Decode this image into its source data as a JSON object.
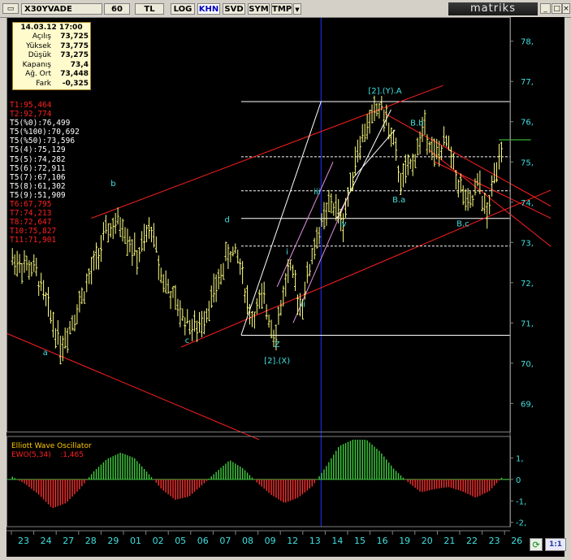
{
  "toolbar": {
    "symbol": "X30YVADE",
    "period": "60",
    "buttons": [
      "TL",
      "LOG",
      "KHN",
      "SVD",
      "SYM",
      "TMP"
    ],
    "active_button": "KHN",
    "brand": "matriks",
    "window_controls": [
      "_",
      "□",
      "×"
    ]
  },
  "infobox": {
    "datetime": "14.03.12 17:00",
    "rows": [
      {
        "label": "Açılış",
        "value": "73,725"
      },
      {
        "label": "Yüksek",
        "value": "73,775"
      },
      {
        "label": "Düşük",
        "value": "73,275"
      },
      {
        "label": "Kapanış",
        "value": "73,4"
      },
      {
        "label": "Ağ. Ort",
        "value": "73,448"
      },
      {
        "label": "Fark",
        "value": "-0,325"
      }
    ]
  },
  "levels": [
    {
      "text": "T1:95,464",
      "color": "#ff2020"
    },
    {
      "text": "T2:92,774",
      "color": "#ff2020"
    },
    {
      "text": "T5(%0):76,499",
      "color": "#ffffff"
    },
    {
      "text": "T5(%100):70,692",
      "color": "#ffffff"
    },
    {
      "text": "T5(%50):73,596",
      "color": "#ffffff"
    },
    {
      "text": "T5(4):75,129",
      "color": "#ffffff"
    },
    {
      "text": "T5(5):74,282",
      "color": "#ffffff"
    },
    {
      "text": "T5(6):72,911",
      "color": "#ffffff"
    },
    {
      "text": "T5(7):67,106",
      "color": "#ffffff"
    },
    {
      "text": "T5(8):61,302",
      "color": "#ffffff"
    },
    {
      "text": "T5(9):51,909",
      "color": "#ffffff"
    },
    {
      "text": "T6:67,795",
      "color": "#ff2020"
    },
    {
      "text": "T7:74,213",
      "color": "#ff2020"
    },
    {
      "text": "T8:72,647",
      "color": "#ff2020"
    },
    {
      "text": "T10:75,827",
      "color": "#ff2020"
    },
    {
      "text": "T11:71,901",
      "color": "#ff2020"
    }
  ],
  "oscillator": {
    "title": "Elliott Wave Oscillator",
    "label": "EWO(5,34)",
    "value": ":1,465",
    "ticks": [
      {
        "v": 1,
        "label": "1,"
      },
      {
        "v": 0,
        "label": "0"
      },
      {
        "v": -1,
        "label": "-1,"
      },
      {
        "v": -2,
        "label": "-2,"
      }
    ]
  },
  "colors": {
    "background": "#000000",
    "price_bars": "#ffff80",
    "trendline": "#ff2020",
    "channel": "#ffffff",
    "channel_violet": "#e090e0",
    "labels": "#40e0e0",
    "axis_text": "#40e0e0",
    "osc_positive": "#40d040",
    "osc_negative": "#ff3030"
  },
  "chart_data": {
    "type": "ohlc",
    "title": "X30YVADE 60",
    "y_axis_ticks": [
      {
        "v": 78,
        "label": "78,"
      },
      {
        "v": 77,
        "label": "77,"
      },
      {
        "v": 76,
        "label": "76,"
      },
      {
        "v": 75,
        "label": "75,"
      },
      {
        "v": 74,
        "label": "74,"
      },
      {
        "v": 73,
        "label": "73,"
      },
      {
        "v": 72,
        "label": "72,"
      },
      {
        "v": 71,
        "label": "71,"
      },
      {
        "v": 70,
        "label": "70,"
      },
      {
        "v": 69,
        "label": "69,"
      }
    ],
    "ylim": [
      68.3,
      78.6
    ],
    "x_tick_labels": [
      "23",
      "24",
      "27",
      "28",
      "29",
      "01",
      "02",
      "05",
      "06",
      "07",
      "08",
      "09",
      "12",
      "13",
      "14",
      "15",
      "16",
      "19",
      "20",
      "21",
      "22",
      "23",
      "26"
    ],
    "price_path": [
      [
        0,
        72.6
      ],
      [
        1.2,
        72.3
      ],
      [
        2.5,
        70.4
      ],
      [
        3.5,
        71.6
      ],
      [
        4.8,
        73.3
      ],
      [
        5.5,
        73.5
      ],
      [
        6.3,
        72.6
      ],
      [
        7.0,
        73.4
      ],
      [
        7.5,
        72.2
      ],
      [
        8.5,
        71.2
      ],
      [
        9.3,
        70.8
      ],
      [
        10.2,
        71.8
      ],
      [
        10.9,
        72.8
      ],
      [
        11.4,
        72.6
      ],
      [
        12.0,
        71.1
      ],
      [
        12.6,
        71.6
      ],
      [
        13.2,
        70.7
      ],
      [
        13.9,
        72.4
      ],
      [
        14.5,
        71.4
      ],
      [
        15.2,
        73.0
      ],
      [
        16.0,
        74.0
      ],
      [
        16.6,
        73.5
      ],
      [
        17.3,
        75.3
      ],
      [
        18.0,
        76.1
      ],
      [
        18.5,
        76.4
      ],
      [
        19.1,
        75.5
      ],
      [
        19.5,
        74.5
      ],
      [
        20.1,
        75.0
      ],
      [
        20.7,
        75.9
      ],
      [
        21.2,
        75.1
      ],
      [
        21.8,
        75.5
      ],
      [
        22.3,
        74.6
      ],
      [
        22.9,
        73.8
      ],
      [
        23.4,
        74.5
      ],
      [
        23.8,
        73.6
      ],
      [
        24.3,
        75.0
      ],
      [
        24.6,
        75.6
      ]
    ],
    "horizontal_levels": [
      {
        "v": 76.5,
        "style": "solid",
        "x_from": 11.5
      },
      {
        "v": 75.129,
        "style": "dashed",
        "x_from": 11.5
      },
      {
        "v": 74.282,
        "style": "dashed",
        "x_from": 11.5
      },
      {
        "v": 73.596,
        "style": "solid",
        "x_from": 11.5
      },
      {
        "v": 72.911,
        "style": "dashed",
        "x_from": 11.5
      },
      {
        "v": 70.692,
        "style": "solid",
        "x_from": 11.5
      }
    ],
    "short_level": {
      "v": 75.55,
      "x_from": 24.4,
      "x_to": 26.0
    },
    "red_lines": [
      [
        [
          4.0,
          73.6
        ],
        [
          21.6,
          76.9
        ]
      ],
      [
        [
          -1.0,
          70.9
        ],
        [
          12.4,
          68.1
        ]
      ],
      [
        [
          8.5,
          70.4
        ],
        [
          27.0,
          74.3
        ]
      ],
      [
        [
          18.7,
          76.2
        ],
        [
          27.0,
          73.9
        ]
      ],
      [
        [
          20.9,
          75.3
        ],
        [
          27.0,
          72.9
        ]
      ],
      [
        [
          21.2,
          75.0
        ],
        [
          27.0,
          73.6
        ]
      ]
    ],
    "white_lines": [
      [
        [
          11.5,
          70.7
        ],
        [
          15.5,
          76.5
        ]
      ],
      [
        [
          16.3,
          73.6
        ],
        [
          19.0,
          76.3
        ]
      ],
      [
        [
          17.1,
          74.6
        ],
        [
          19.2,
          75.8
        ]
      ]
    ],
    "violet_lines": [
      [
        [
          13.3,
          71.9
        ],
        [
          16.1,
          75.0
        ]
      ],
      [
        [
          14.1,
          71.0
        ],
        [
          16.9,
          74.2
        ]
      ]
    ],
    "wave_labels": [
      {
        "text": "a",
        "x": 1.7,
        "y": 70.2
      },
      {
        "text": "b",
        "x": 5.1,
        "y": 74.4
      },
      {
        "text": "c",
        "x": 8.8,
        "y": 70.5
      },
      {
        "text": "d",
        "x": 10.8,
        "y": 73.5
      },
      {
        "text": "Z",
        "x": 13.3,
        "y": 70.4
      },
      {
        "text": "[2].(X)",
        "x": 13.3,
        "y": 70.0
      },
      {
        "text": "i",
        "x": 13.8,
        "y": 72.7
      },
      {
        "text": "ii",
        "x": 14.6,
        "y": 71.4
      },
      {
        "text": "iii",
        "x": 15.3,
        "y": 74.2
      },
      {
        "text": "iv",
        "x": 16.6,
        "y": 73.4
      },
      {
        "text": "[2].(Y).A",
        "x": 18.7,
        "y": 76.7
      },
      {
        "text": "B.a",
        "x": 19.4,
        "y": 74.0
      },
      {
        "text": "B.b",
        "x": 20.3,
        "y": 75.9
      },
      {
        "text": "B.c",
        "x": 22.6,
        "y": 73.4
      }
    ],
    "cursor_x": 15.5,
    "ewo": [
      0.15,
      -0.2,
      -0.7,
      -1.35,
      -1.1,
      -0.45,
      0.35,
      0.95,
      1.25,
      1.0,
      0.3,
      -0.45,
      -0.95,
      -0.8,
      -0.25,
      0.35,
      0.9,
      0.5,
      -0.15,
      -0.7,
      -1.1,
      -0.85,
      -0.35,
      0.55,
      1.55,
      1.85,
      1.85,
      1.3,
      0.5,
      -0.1,
      -0.6,
      -0.45,
      -0.35,
      -0.55,
      -0.85,
      -0.55,
      0.15
    ],
    "ewo_ylim": [
      -2.2,
      2.0
    ]
  }
}
